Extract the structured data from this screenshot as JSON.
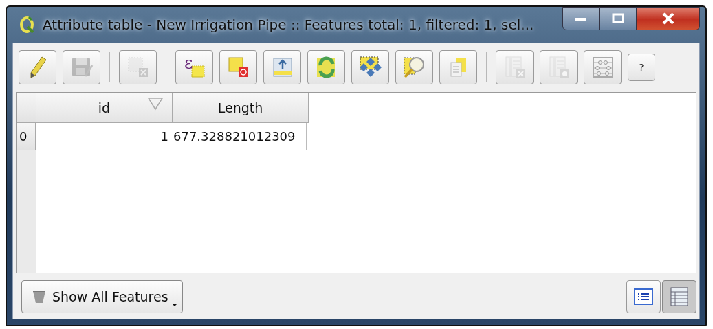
{
  "window": {
    "title": "Attribute table - New Irrigation Pipe :: Features total: 1, filtered: 1, sel..."
  },
  "toolbar": {
    "groups": [
      [
        {
          "kind": "pencil",
          "disabled": false
        },
        {
          "kind": "save",
          "disabled": true
        }
      ],
      [
        {
          "kind": "delete-selected",
          "disabled": true
        }
      ],
      [
        {
          "kind": "expression",
          "disabled": false,
          "glyph": "ε"
        },
        {
          "kind": "deselect",
          "disabled": false
        },
        {
          "kind": "move-top",
          "disabled": false
        },
        {
          "kind": "invert",
          "disabled": false
        },
        {
          "kind": "pan",
          "disabled": false
        },
        {
          "kind": "zoom",
          "disabled": false
        },
        {
          "kind": "copy",
          "disabled": false
        }
      ],
      [
        {
          "kind": "delete-column",
          "disabled": true
        },
        {
          "kind": "new-column",
          "disabled": true
        },
        {
          "kind": "calculator",
          "disabled": false
        },
        {
          "kind": "help",
          "disabled": false,
          "label": "?"
        }
      ]
    ]
  },
  "table": {
    "columns": [
      {
        "label": "id",
        "sorted": true
      },
      {
        "label": "Length",
        "sorted": false
      }
    ],
    "rows": [
      {
        "header": "0",
        "cells": [
          "1",
          "677.328821012309"
        ]
      }
    ]
  },
  "footer": {
    "filter_button": "Show All Features",
    "views": [
      {
        "kind": "form",
        "selected": false
      },
      {
        "kind": "table",
        "selected": true
      }
    ]
  }
}
